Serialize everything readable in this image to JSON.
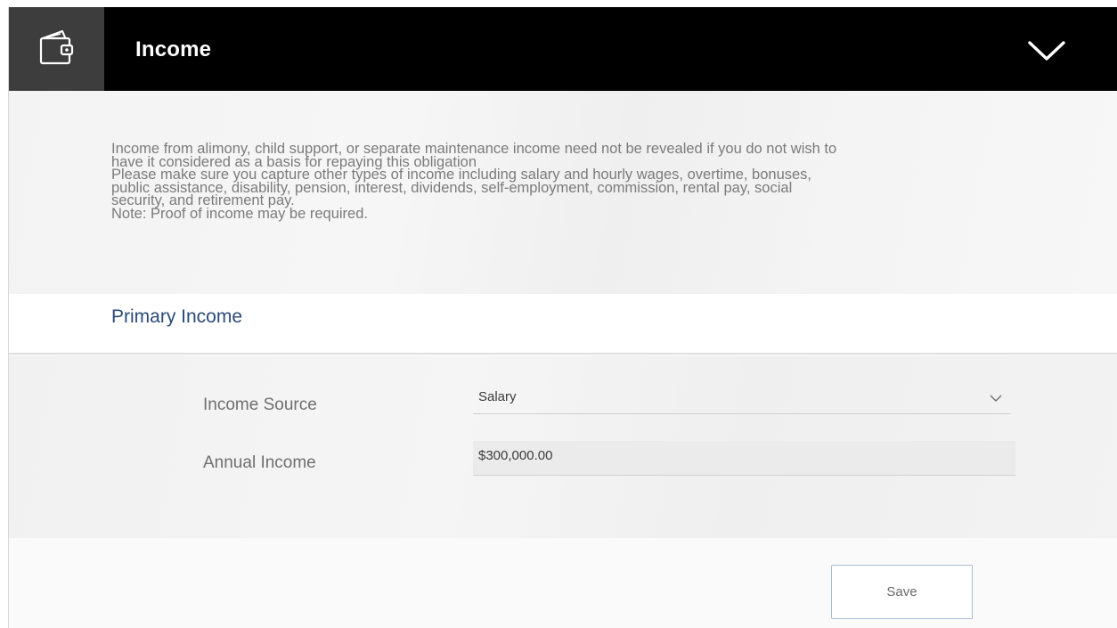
{
  "header": {
    "title": "Income",
    "icon": "wallet-icon",
    "toggle_icon": "chevron-down-icon"
  },
  "info": {
    "lines": [
      "Income from alimony, child support, or separate maintenance income need not be revealed if you do not wish to",
      "have it considered as a basis for repaying this obligation",
      "Please make sure you capture other types of income including salary and hourly wages, overtime, bonuses,",
      "public assistance, disability, pension, interest, dividends, self-employment, commission, rental pay, social",
      "security, and retirement pay.",
      "Note: Proof of income may be required."
    ]
  },
  "section": {
    "title": "Primary Income"
  },
  "form": {
    "income_source": {
      "label": "Income Source",
      "value": "Salary"
    },
    "annual_income": {
      "label": "Annual Income",
      "value": "$300,000.00"
    },
    "save_label": "Save"
  },
  "colors": {
    "header_bg": "#000000",
    "icon_box_bg": "#3d3d3d",
    "section_title": "#2b4a7a",
    "button_border": "#a9bcd6"
  }
}
